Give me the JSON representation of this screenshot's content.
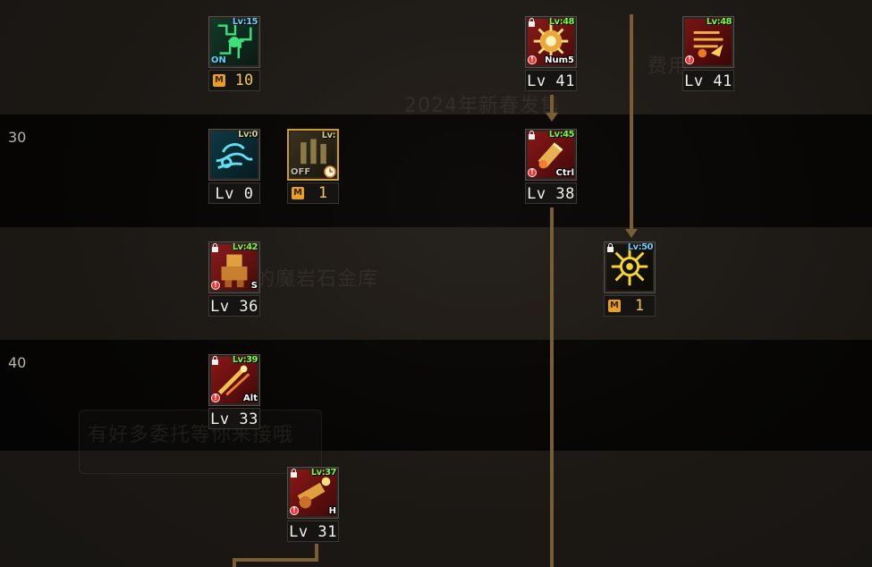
{
  "background_text": {
    "line1": "2024年新春发售",
    "line2": "面的魔岩石金库",
    "line3": "有好多委托等你来接哦",
    "line4": "费用"
  },
  "rows": {
    "label_30": "30",
    "label_40": "40"
  },
  "skills": [
    {
      "id": "s1",
      "req": "Lv:15",
      "req_color": "blue",
      "bottom_kind": "sp",
      "badge": "M",
      "value": "10",
      "toggle": "ON",
      "locked": false,
      "alert": false,
      "key": ""
    },
    {
      "id": "s2",
      "req": "Lv:48",
      "req_color": "green",
      "bottom_kind": "lv",
      "value": "Lv 41",
      "locked": true,
      "alert": true,
      "key": "Num5"
    },
    {
      "id": "s3",
      "req": "Lv:48",
      "req_color": "green",
      "bottom_kind": "lv",
      "value": "Lv 41",
      "locked": false,
      "alert": true,
      "key": ""
    },
    {
      "id": "s4",
      "req": "Lv:0",
      "req_color": "olive",
      "bottom_kind": "lv",
      "value": "Lv 0",
      "locked": false,
      "alert": false,
      "key": ""
    },
    {
      "id": "s5",
      "req": "Lv:",
      "req_color": "olive",
      "bottom_kind": "sp",
      "badge": "M",
      "value": "1",
      "toggle": "OFF",
      "locked": false,
      "alert": false,
      "key": ""
    },
    {
      "id": "s6",
      "req": "Lv:45",
      "req_color": "green",
      "bottom_kind": "lv",
      "value": "Lv 38",
      "locked": true,
      "alert": true,
      "key": "Ctrl"
    },
    {
      "id": "s7",
      "req": "Lv:42",
      "req_color": "green",
      "bottom_kind": "lv",
      "value": "Lv 36",
      "locked": true,
      "alert": true,
      "key": "S"
    },
    {
      "id": "s8",
      "req": "Lv:50",
      "req_color": "blue",
      "bottom_kind": "sp",
      "badge": "M",
      "value": "1",
      "locked": true,
      "alert": false,
      "key": ""
    },
    {
      "id": "s9",
      "req": "Lv:39",
      "req_color": "green",
      "bottom_kind": "lv",
      "value": "Lv 33",
      "locked": true,
      "alert": true,
      "key": "Alt"
    },
    {
      "id": "s10",
      "req": "Lv:37",
      "req_color": "green",
      "bottom_kind": "lv",
      "value": "Lv 31",
      "locked": true,
      "alert": true,
      "key": "H"
    }
  ],
  "colors": {
    "connector": "#7a5c35",
    "lv_text": "#f2f0ea",
    "sp_text": "#f3c45a",
    "req_green": "#7cff3a",
    "req_blue": "#6fd0ff",
    "alert": "#ff2a2a"
  }
}
